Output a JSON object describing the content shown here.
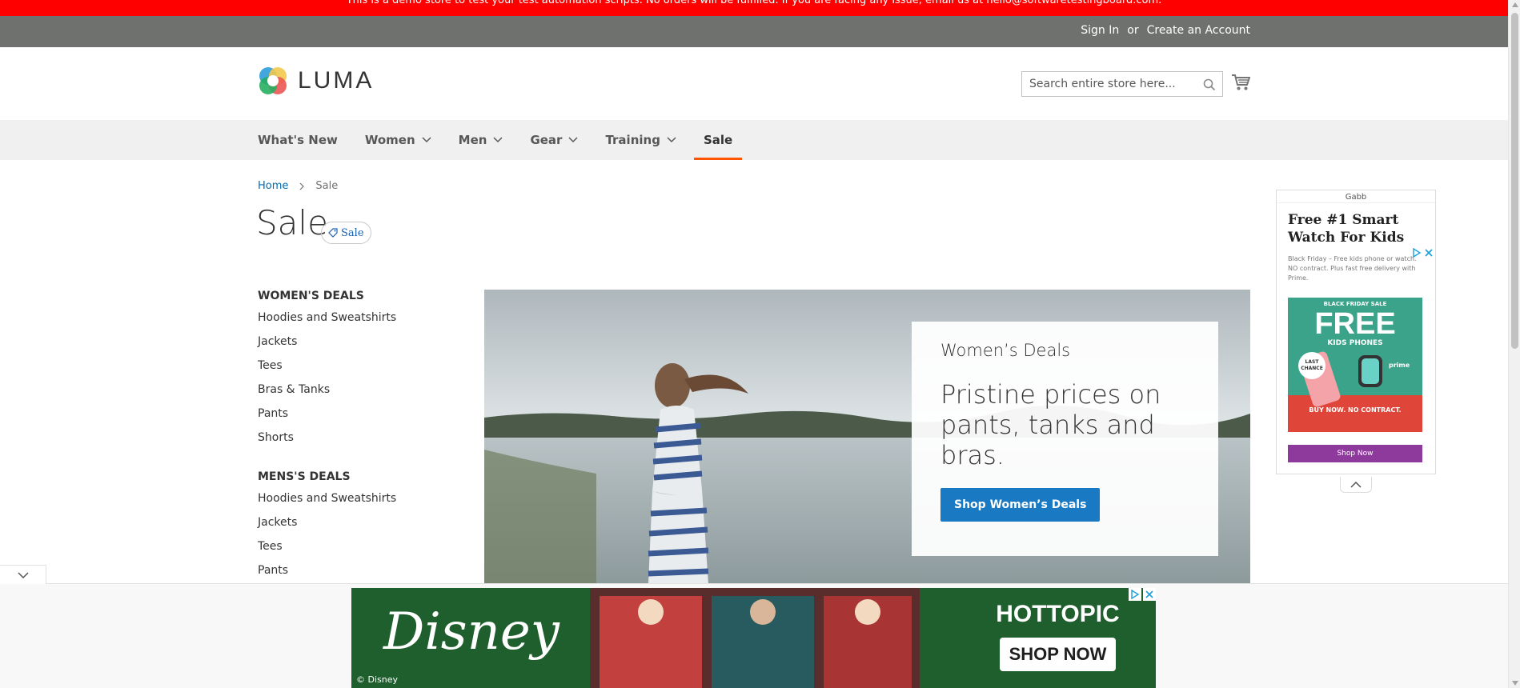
{
  "demo_notice": "This is a demo store to test your test automation scripts. No orders will be fulfilled. If you are facing any issue, email us at hello@softwaretestingboard.com.",
  "top_links": {
    "sign_in": "Sign In",
    "or": "or",
    "create_account": "Create an Account"
  },
  "logo": {
    "text": "LUMA",
    "icon": "luma-logo-icon"
  },
  "search": {
    "placeholder": "Search entire store here...",
    "value": ""
  },
  "nav": {
    "items": [
      {
        "label": "What's New",
        "has_dropdown": false
      },
      {
        "label": "Women",
        "has_dropdown": true
      },
      {
        "label": "Men",
        "has_dropdown": true
      },
      {
        "label": "Gear",
        "has_dropdown": true
      },
      {
        "label": "Training",
        "has_dropdown": true
      },
      {
        "label": "Sale",
        "has_dropdown": false,
        "active": true
      }
    ]
  },
  "breadcrumb": {
    "home": "Home",
    "current": "Sale"
  },
  "page": {
    "title": "Sale",
    "badge": "Sale"
  },
  "sidebar": {
    "womens_title": "WOMEN'S DEALS",
    "womens_items": [
      "Hoodies and Sweatshirts",
      "Jackets",
      "Tees",
      "Bras & Tanks",
      "Pants",
      "Shorts"
    ],
    "mens_title": "MENS'S DEALS",
    "mens_items": [
      "Hoodies and Sweatshirts",
      "Jackets",
      "Tees",
      "Pants"
    ]
  },
  "hero": {
    "subtitle": "Women’s Deals",
    "headline": "Pristine prices on pants, tanks and bras.",
    "button": "Shop Women’s Deals"
  },
  "side_ad": {
    "brand": "Gabb",
    "headline": "Free #1 Smart Watch For Kids",
    "description": "Black Friday – Free kids phone or watch. NO contract. Plus fast free delivery with Prime.",
    "promo_banner": "BLACK FRIDAY SALE",
    "promo_big": "FREE",
    "promo_sub": "KIDS PHONES",
    "promo_badge": "LAST CHANCE",
    "promo_cta": "BUY NOW. NO CONTRACT.",
    "promo_prime": "prime",
    "shop_now": "Shop Now"
  },
  "bottom_ad": {
    "brand_left": "Disney",
    "copyright": "© Disney",
    "brand_right": "HOTTOPIC",
    "cta": "SHOP NOW"
  },
  "colors": {
    "demo_bar": "#ff0000",
    "top_panel": "#6e716e",
    "link": "#006bb4",
    "primary_button": "#1979c3",
    "active_nav": "#ff5501"
  }
}
